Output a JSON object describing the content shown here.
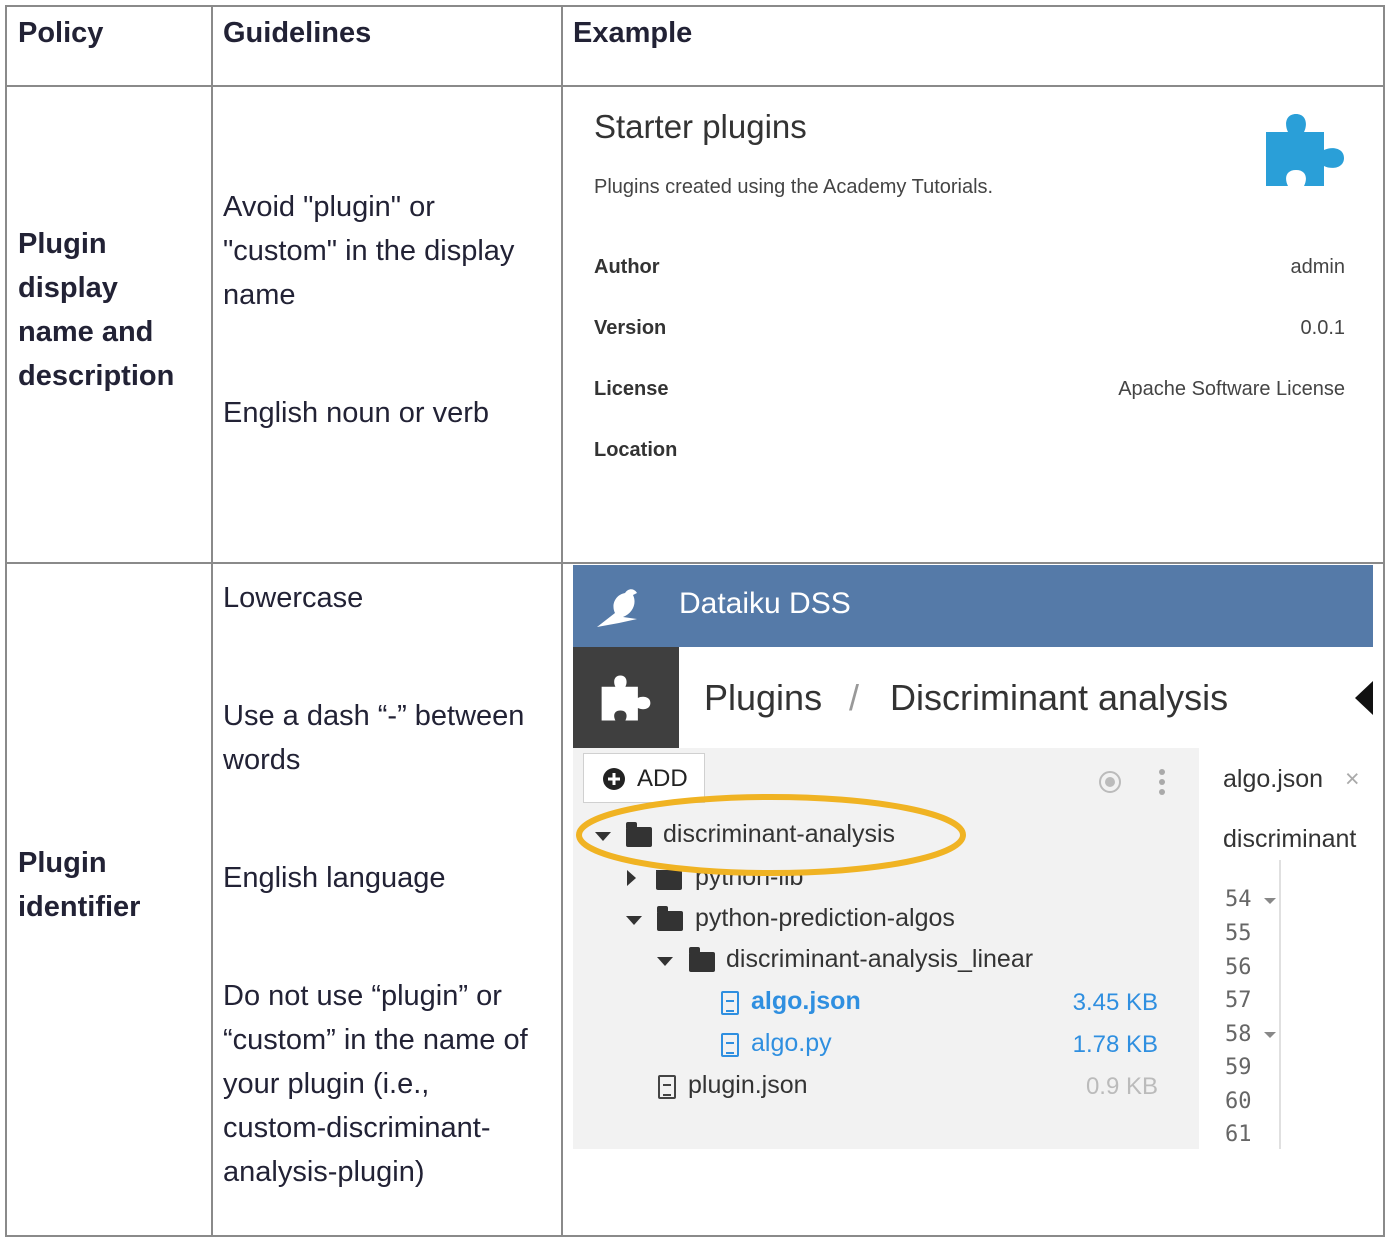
{
  "table": {
    "headers": [
      "Policy",
      "Guidelines",
      "Example"
    ],
    "rows": [
      {
        "policy": [
          "Plugin",
          "display",
          "name and",
          "description"
        ],
        "guidelines": [
          [
            "Avoid \"plugin\" or",
            "\"custom\" in the display",
            "name"
          ],
          [
            "English noun or verb"
          ]
        ]
      },
      {
        "policy": [
          "Plugin",
          "identifier"
        ],
        "guidelines": [
          [
            "Lowercase"
          ],
          [
            "Use a dash “-” between",
            "words"
          ],
          [
            "English language"
          ],
          [
            "Do not use “plugin” or",
            "“custom” in the name of",
            "your plugin (i.e.,",
            "custom-discriminant-",
            "analysis-plugin)"
          ]
        ]
      }
    ]
  },
  "starter_card": {
    "title": "Starter plugins",
    "description": "Plugins created using the Academy Tutorials.",
    "fields": [
      {
        "key": "Author",
        "value": "admin"
      },
      {
        "key": "Version",
        "value": "0.0.1"
      },
      {
        "key": "License",
        "value": "Apache Software License"
      },
      {
        "key": "Location",
        "value": ""
      }
    ],
    "icon": "puzzle-piece-icon",
    "icon_color": "#2a9fd8"
  },
  "dss": {
    "brand": "Dataiku DSS",
    "crumb_root": "Plugins",
    "crumb_sep": "/",
    "crumb_current": "Discriminant analysis",
    "add_label": "ADD",
    "tree": [
      {
        "name": "discriminant-analysis",
        "type": "folder"
      },
      {
        "name": "python-lib",
        "type": "folder"
      },
      {
        "name": "python-prediction-algos",
        "type": "folder"
      },
      {
        "name": "discriminant-analysis_linear",
        "type": "folder"
      },
      {
        "name": "algo.json",
        "type": "file",
        "size": "3.45 KB"
      },
      {
        "name": "algo.py",
        "type": "file",
        "size": "1.78 KB"
      },
      {
        "name": "plugin.json",
        "type": "file",
        "size": "0.9 KB"
      }
    ],
    "tab_name": "algo.json",
    "tab_close": "×",
    "editor_header": "discriminant",
    "line_numbers": [
      "54",
      "55",
      "56",
      "57",
      "58",
      "59",
      "60",
      "61"
    ],
    "header_color": "#557aa8",
    "highlight_color": "#f0b323",
    "link_color": "#2f8fe0"
  }
}
